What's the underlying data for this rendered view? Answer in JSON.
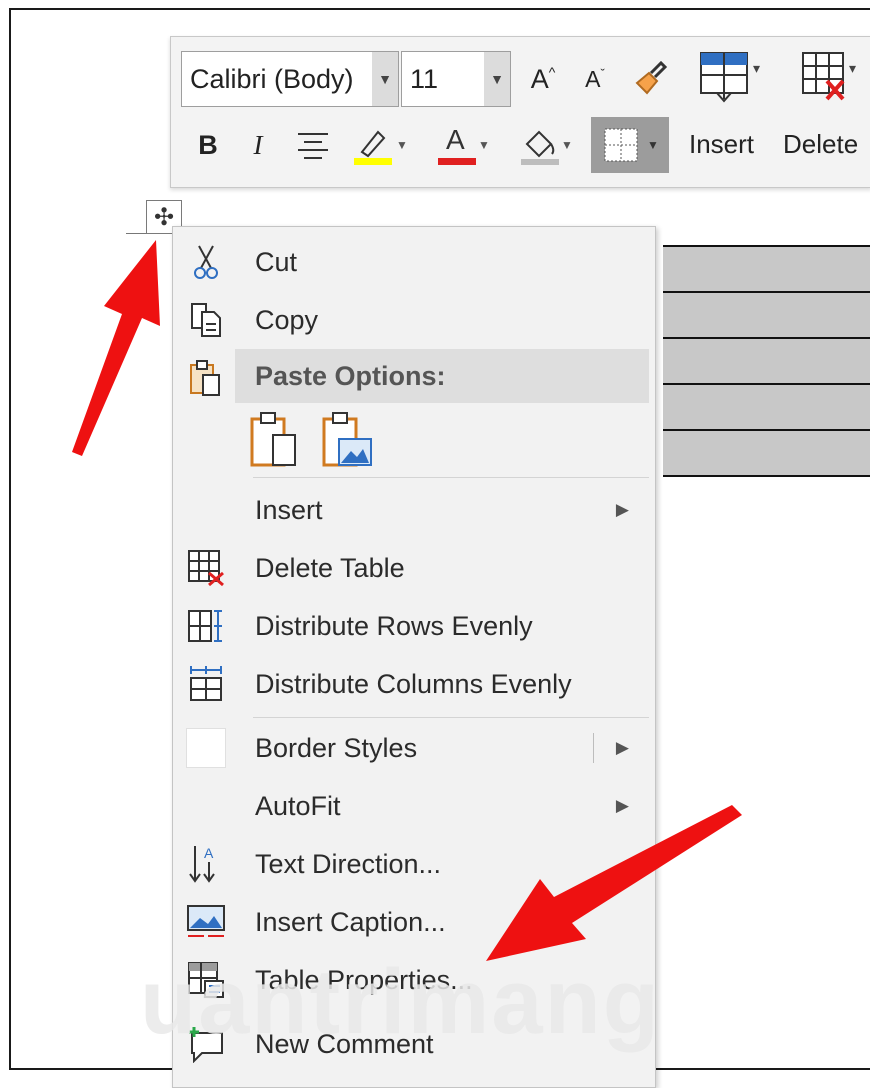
{
  "toolbar": {
    "font_name": "Calibri (Body)",
    "font_size": "11",
    "grow_font": "A",
    "shrink_font": "A",
    "bold": "B",
    "italic": "I",
    "font_color_letter": "A",
    "insert_label": "Insert",
    "delete_label": "Delete"
  },
  "context_menu": {
    "cut": "Cut",
    "copy": "Copy",
    "paste_options": "Paste Options:",
    "insert": "Insert",
    "delete_table": "Delete Table",
    "distribute_rows": "Distribute Rows Evenly",
    "distribute_columns": "Distribute Columns Evenly",
    "border_styles": "Border Styles",
    "autofit": "AutoFit",
    "text_direction": "Text Direction...",
    "insert_caption": "Insert Caption...",
    "table_properties": "Table Properties...",
    "new_comment": "New Comment"
  },
  "watermark": "uantrimang",
  "colors": {
    "highlight": "#ffff00",
    "font_color": "#e02020",
    "arrow": "#ee1111",
    "table_fill": "#c8c8c8"
  }
}
